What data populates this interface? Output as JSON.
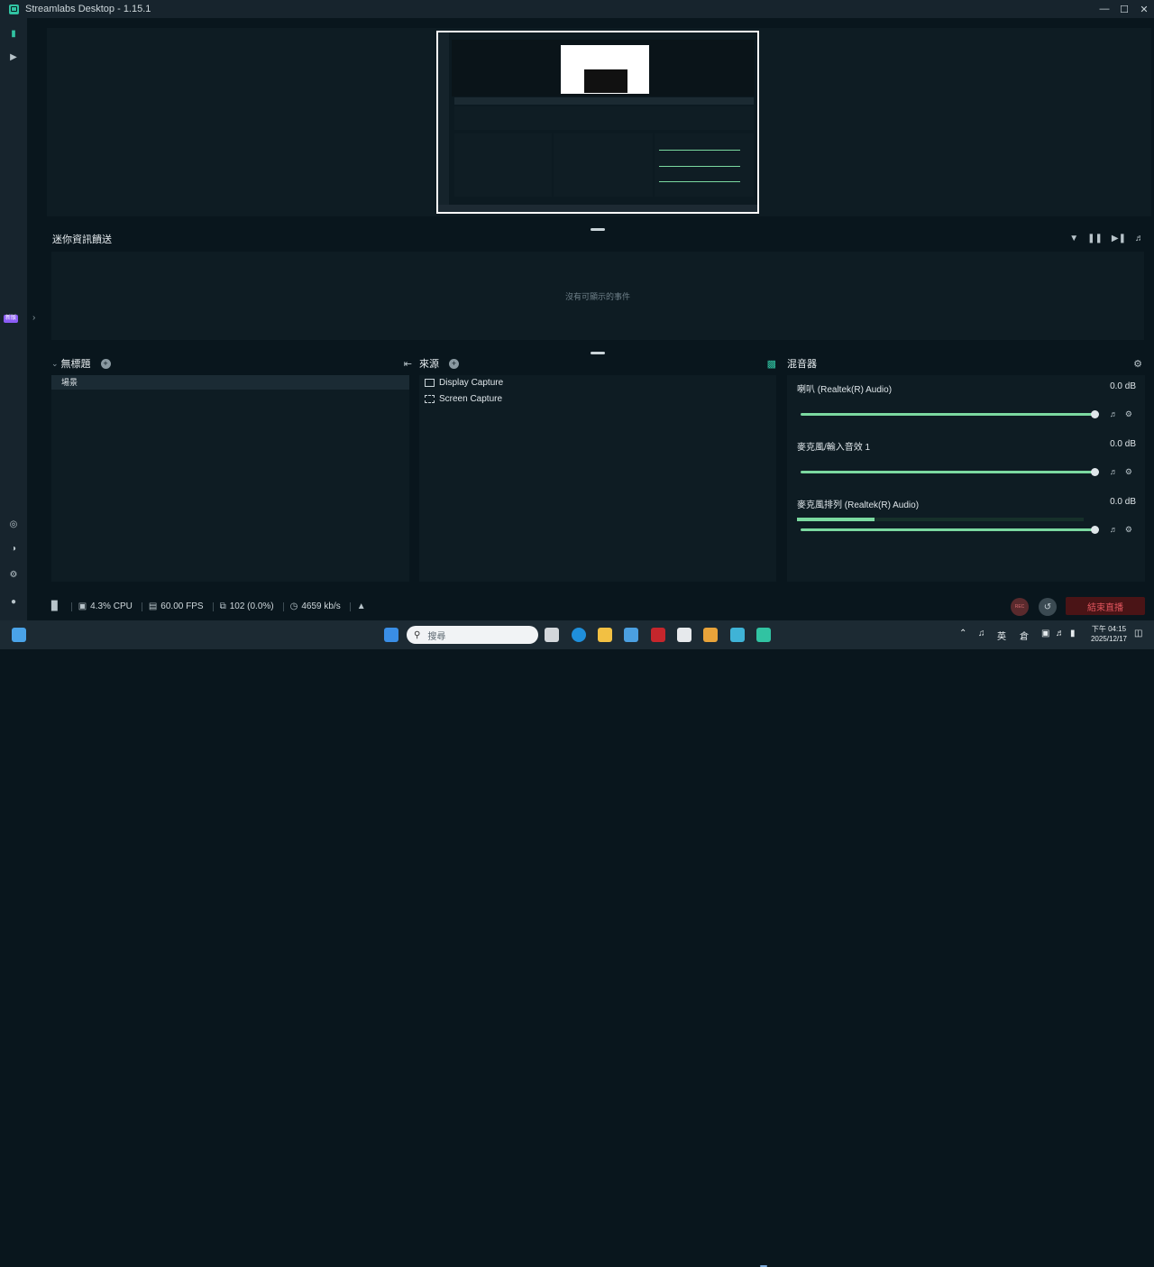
{
  "window": {
    "title": "Streamlabs Desktop - 1.15.1",
    "controls": [
      "minimize",
      "maximize",
      "close"
    ]
  },
  "sidebar": {
    "ad_badge": "新版"
  },
  "events": {
    "title": "迷你資訊饋送",
    "empty_text": "沒有可顯示的事件"
  },
  "scenes": {
    "title": "無標題",
    "items": [
      "場景"
    ]
  },
  "sources": {
    "title": "來源",
    "items": [
      {
        "label": "Display Capture",
        "icon": "monitor-icon"
      },
      {
        "label": "Screen Capture",
        "icon": "region-icon"
      }
    ]
  },
  "mixer": {
    "title": "混音器",
    "channels": [
      {
        "name": "喇叭 (Realtek(R) Audio)",
        "db": "0.0 dB",
        "volume": 1.0
      },
      {
        "name": "麥克風/輸入音效 1",
        "db": "0.0 dB",
        "volume": 1.0
      },
      {
        "name": "麥克風排列 (Realtek(R) Audio)",
        "db": "0.0 dB",
        "volume": 1.0,
        "meter_level": 0.27
      }
    ]
  },
  "status": {
    "cpu": "4.3% CPU",
    "fps": "60.00 FPS",
    "dropped": "102 (0.0%)",
    "bitrate": "4659 kb/s",
    "rec_label": "REC",
    "end_stream": "結束直播"
  },
  "taskbar": {
    "search_placeholder": "搜尋",
    "ime": "英",
    "ime2": "倉",
    "time": "下午 04:15",
    "date": "2025/12/17"
  },
  "colors": {
    "accent": "#31c3a2",
    "slider": "#7bd9a0",
    "danger": "#e0555d"
  }
}
